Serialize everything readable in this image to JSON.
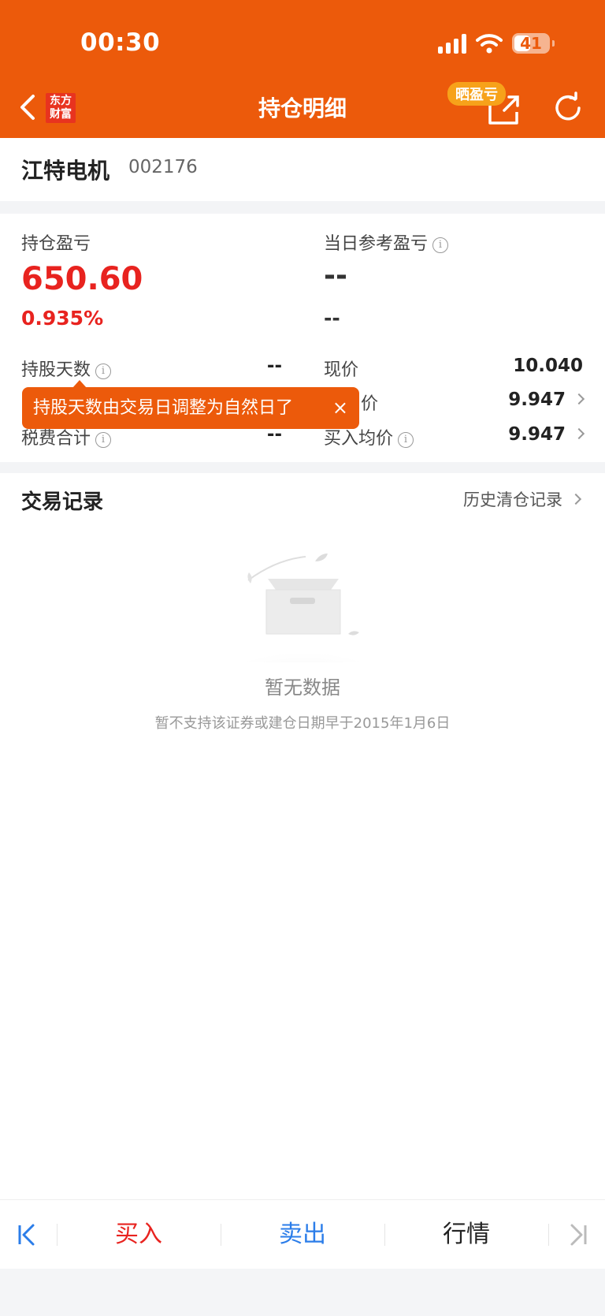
{
  "status_bar": {
    "time": "00:30",
    "battery": "41"
  },
  "header": {
    "brand_line1": "东方",
    "brand_line2": "财富",
    "title": "持仓明细",
    "share_badge": "晒盈亏",
    "accent_color": "#ec5a0b"
  },
  "stock": {
    "name": "江特电机",
    "code": "002176"
  },
  "summary": {
    "pl_label": "持仓盈亏",
    "pl_value": "650.60",
    "pl_pct": "0.935%",
    "daily_label": "当日参考盈亏",
    "daily_value": "--",
    "daily_pct": "--",
    "hold_days_label": "持股天数",
    "hold_days_value": "--",
    "fee_label": "税费合计",
    "fee_value": "--",
    "price_label": "现价",
    "price_value": "10.040",
    "cost_label_partial": "价",
    "cost_value": "9.947",
    "buy_avg_label": "买入均价",
    "buy_avg_value": "9.947",
    "tooltip": "持股天数由交易日调整为自然日了",
    "tooltip_close": "×"
  },
  "records": {
    "title": "交易记录",
    "history_link": "历史清仓记录",
    "empty_title": "暂无数据",
    "empty_note": "暂不支持该证券或建仓日期早于2015年1月6日"
  },
  "bottom_bar": {
    "buy": "买入",
    "sell": "卖出",
    "quote": "行情"
  },
  "colors": {
    "up": "#e8231f",
    "sell_blue": "#2b7de9"
  }
}
